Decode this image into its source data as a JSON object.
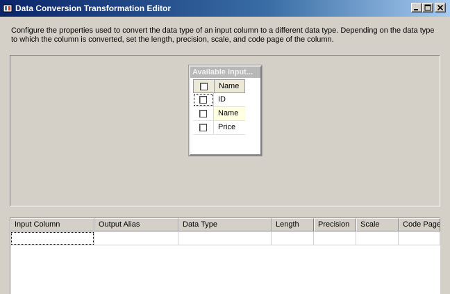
{
  "window": {
    "title": "Data Conversion Transformation Editor",
    "icon": "transform-icon",
    "buttons": [
      "minimize-icon",
      "maximize-icon",
      "close-icon"
    ]
  },
  "description": "Configure the properties used to convert the data type of an input column to a different data type. Depending on the data type to which the column is converted, set the length, precision, scale, and code page of the column.",
  "available_inputs": {
    "title": "Available Input...",
    "header_label": "Name",
    "columns": [
      {
        "name": "ID",
        "checked": false
      },
      {
        "name": "Name",
        "checked": false
      },
      {
        "name": "Price",
        "checked": false
      }
    ]
  },
  "mapping_table": {
    "columns": [
      "Input Column",
      "Output Alias",
      "Data Type",
      "Length",
      "Precision",
      "Scale",
      "Code Page"
    ]
  }
}
